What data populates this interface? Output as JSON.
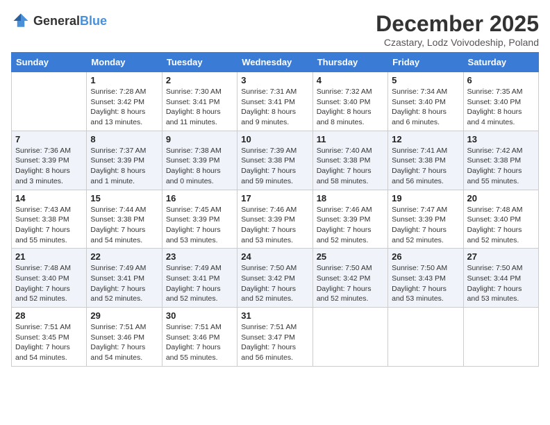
{
  "header": {
    "logo_general": "General",
    "logo_blue": "Blue",
    "title": "December 2025",
    "subtitle": "Czastary, Lodz Voivodeship, Poland"
  },
  "weekdays": [
    "Sunday",
    "Monday",
    "Tuesday",
    "Wednesday",
    "Thursday",
    "Friday",
    "Saturday"
  ],
  "weeks": [
    [
      {
        "day": "",
        "sunrise": "",
        "sunset": "",
        "daylight": ""
      },
      {
        "day": "1",
        "sunrise": "Sunrise: 7:28 AM",
        "sunset": "Sunset: 3:42 PM",
        "daylight": "Daylight: 8 hours and 13 minutes."
      },
      {
        "day": "2",
        "sunrise": "Sunrise: 7:30 AM",
        "sunset": "Sunset: 3:41 PM",
        "daylight": "Daylight: 8 hours and 11 minutes."
      },
      {
        "day": "3",
        "sunrise": "Sunrise: 7:31 AM",
        "sunset": "Sunset: 3:41 PM",
        "daylight": "Daylight: 8 hours and 9 minutes."
      },
      {
        "day": "4",
        "sunrise": "Sunrise: 7:32 AM",
        "sunset": "Sunset: 3:40 PM",
        "daylight": "Daylight: 8 hours and 8 minutes."
      },
      {
        "day": "5",
        "sunrise": "Sunrise: 7:34 AM",
        "sunset": "Sunset: 3:40 PM",
        "daylight": "Daylight: 8 hours and 6 minutes."
      },
      {
        "day": "6",
        "sunrise": "Sunrise: 7:35 AM",
        "sunset": "Sunset: 3:40 PM",
        "daylight": "Daylight: 8 hours and 4 minutes."
      }
    ],
    [
      {
        "day": "7",
        "sunrise": "Sunrise: 7:36 AM",
        "sunset": "Sunset: 3:39 PM",
        "daylight": "Daylight: 8 hours and 3 minutes."
      },
      {
        "day": "8",
        "sunrise": "Sunrise: 7:37 AM",
        "sunset": "Sunset: 3:39 PM",
        "daylight": "Daylight: 8 hours and 1 minute."
      },
      {
        "day": "9",
        "sunrise": "Sunrise: 7:38 AM",
        "sunset": "Sunset: 3:39 PM",
        "daylight": "Daylight: 8 hours and 0 minutes."
      },
      {
        "day": "10",
        "sunrise": "Sunrise: 7:39 AM",
        "sunset": "Sunset: 3:38 PM",
        "daylight": "Daylight: 7 hours and 59 minutes."
      },
      {
        "day": "11",
        "sunrise": "Sunrise: 7:40 AM",
        "sunset": "Sunset: 3:38 PM",
        "daylight": "Daylight: 7 hours and 58 minutes."
      },
      {
        "day": "12",
        "sunrise": "Sunrise: 7:41 AM",
        "sunset": "Sunset: 3:38 PM",
        "daylight": "Daylight: 7 hours and 56 minutes."
      },
      {
        "day": "13",
        "sunrise": "Sunrise: 7:42 AM",
        "sunset": "Sunset: 3:38 PM",
        "daylight": "Daylight: 7 hours and 55 minutes."
      }
    ],
    [
      {
        "day": "14",
        "sunrise": "Sunrise: 7:43 AM",
        "sunset": "Sunset: 3:38 PM",
        "daylight": "Daylight: 7 hours and 55 minutes."
      },
      {
        "day": "15",
        "sunrise": "Sunrise: 7:44 AM",
        "sunset": "Sunset: 3:38 PM",
        "daylight": "Daylight: 7 hours and 54 minutes."
      },
      {
        "day": "16",
        "sunrise": "Sunrise: 7:45 AM",
        "sunset": "Sunset: 3:39 PM",
        "daylight": "Daylight: 7 hours and 53 minutes."
      },
      {
        "day": "17",
        "sunrise": "Sunrise: 7:46 AM",
        "sunset": "Sunset: 3:39 PM",
        "daylight": "Daylight: 7 hours and 53 minutes."
      },
      {
        "day": "18",
        "sunrise": "Sunrise: 7:46 AM",
        "sunset": "Sunset: 3:39 PM",
        "daylight": "Daylight: 7 hours and 52 minutes."
      },
      {
        "day": "19",
        "sunrise": "Sunrise: 7:47 AM",
        "sunset": "Sunset: 3:39 PM",
        "daylight": "Daylight: 7 hours and 52 minutes."
      },
      {
        "day": "20",
        "sunrise": "Sunrise: 7:48 AM",
        "sunset": "Sunset: 3:40 PM",
        "daylight": "Daylight: 7 hours and 52 minutes."
      }
    ],
    [
      {
        "day": "21",
        "sunrise": "Sunrise: 7:48 AM",
        "sunset": "Sunset: 3:40 PM",
        "daylight": "Daylight: 7 hours and 52 minutes."
      },
      {
        "day": "22",
        "sunrise": "Sunrise: 7:49 AM",
        "sunset": "Sunset: 3:41 PM",
        "daylight": "Daylight: 7 hours and 52 minutes."
      },
      {
        "day": "23",
        "sunrise": "Sunrise: 7:49 AM",
        "sunset": "Sunset: 3:41 PM",
        "daylight": "Daylight: 7 hours and 52 minutes."
      },
      {
        "day": "24",
        "sunrise": "Sunrise: 7:50 AM",
        "sunset": "Sunset: 3:42 PM",
        "daylight": "Daylight: 7 hours and 52 minutes."
      },
      {
        "day": "25",
        "sunrise": "Sunrise: 7:50 AM",
        "sunset": "Sunset: 3:42 PM",
        "daylight": "Daylight: 7 hours and 52 minutes."
      },
      {
        "day": "26",
        "sunrise": "Sunrise: 7:50 AM",
        "sunset": "Sunset: 3:43 PM",
        "daylight": "Daylight: 7 hours and 53 minutes."
      },
      {
        "day": "27",
        "sunrise": "Sunrise: 7:50 AM",
        "sunset": "Sunset: 3:44 PM",
        "daylight": "Daylight: 7 hours and 53 minutes."
      }
    ],
    [
      {
        "day": "28",
        "sunrise": "Sunrise: 7:51 AM",
        "sunset": "Sunset: 3:45 PM",
        "daylight": "Daylight: 7 hours and 54 minutes."
      },
      {
        "day": "29",
        "sunrise": "Sunrise: 7:51 AM",
        "sunset": "Sunset: 3:46 PM",
        "daylight": "Daylight: 7 hours and 54 minutes."
      },
      {
        "day": "30",
        "sunrise": "Sunrise: 7:51 AM",
        "sunset": "Sunset: 3:46 PM",
        "daylight": "Daylight: 7 hours and 55 minutes."
      },
      {
        "day": "31",
        "sunrise": "Sunrise: 7:51 AM",
        "sunset": "Sunset: 3:47 PM",
        "daylight": "Daylight: 7 hours and 56 minutes."
      },
      {
        "day": "",
        "sunrise": "",
        "sunset": "",
        "daylight": ""
      },
      {
        "day": "",
        "sunrise": "",
        "sunset": "",
        "daylight": ""
      },
      {
        "day": "",
        "sunrise": "",
        "sunset": "",
        "daylight": ""
      }
    ]
  ]
}
